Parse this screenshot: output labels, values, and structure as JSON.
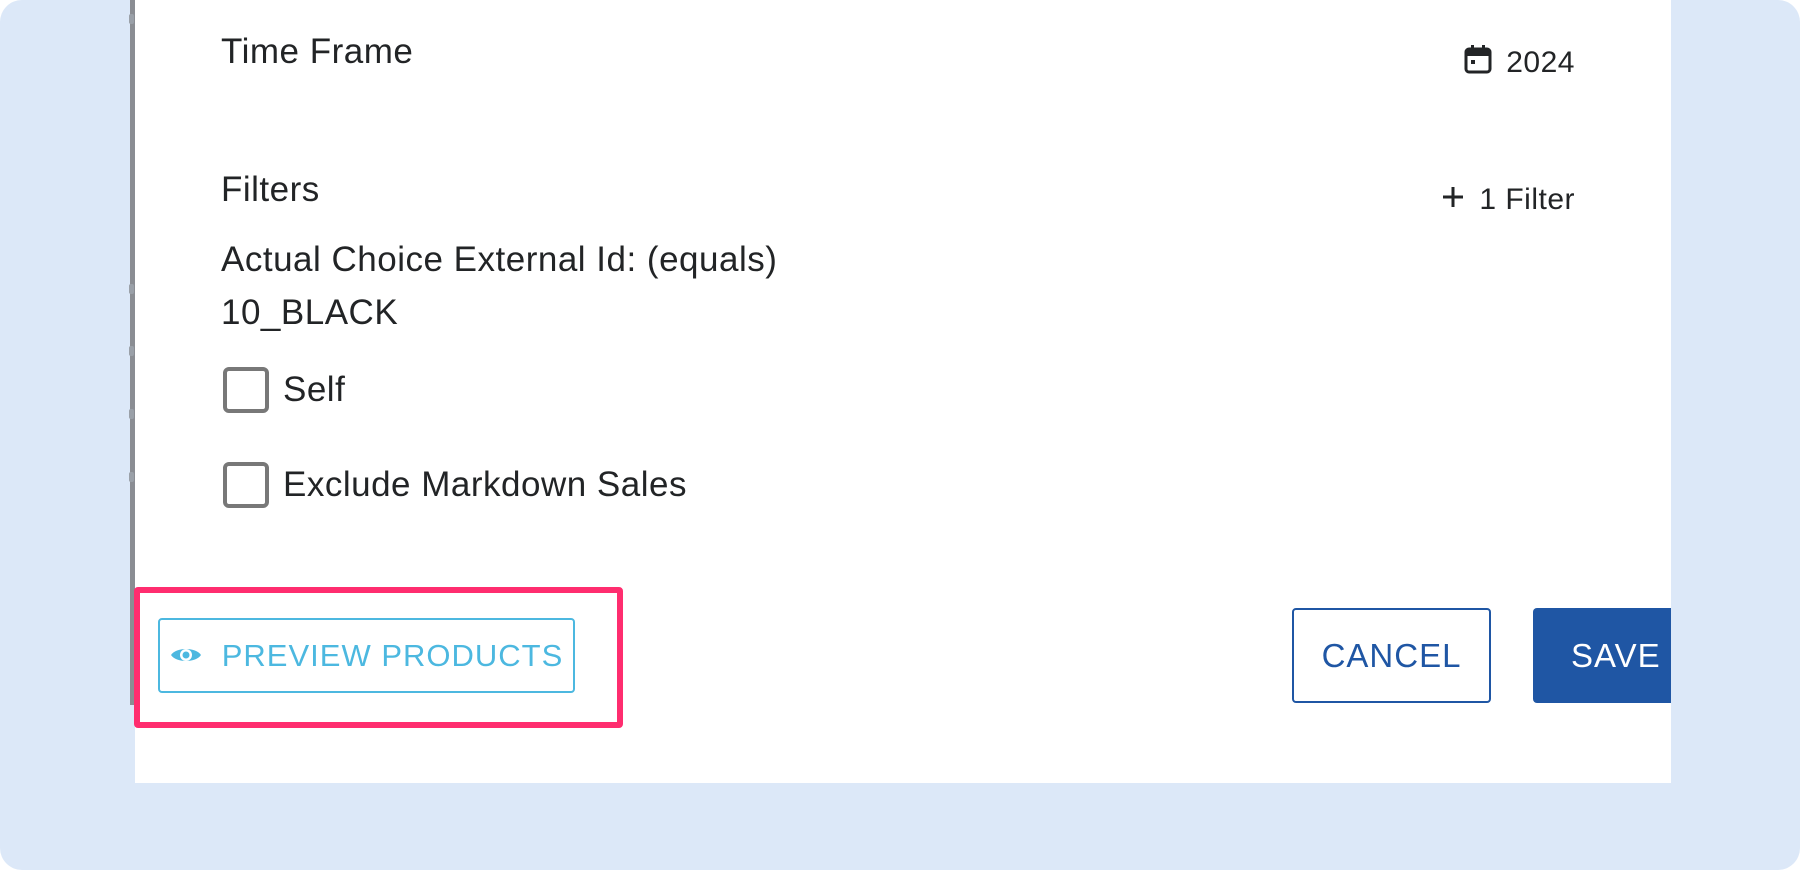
{
  "dialog": {
    "time_frame": {
      "title": "Time Frame",
      "value": "2024",
      "icon": "calendar-icon"
    },
    "filters": {
      "title": "Filters",
      "add_label": "1 Filter",
      "add_icon": "plus-icon",
      "filter_description": "Actual Choice External Id: (equals)",
      "filter_value": "10_BLACK"
    },
    "checkboxes": [
      {
        "label": "Self",
        "checked": false
      },
      {
        "label": "Exclude Markdown Sales",
        "checked": false
      }
    ],
    "actions": {
      "preview_label": "PREVIEW PRODUCTS",
      "preview_icon": "eye-icon",
      "cancel_label": "CANCEL",
      "save_label": "SAVE"
    }
  },
  "colors": {
    "background": "#dce8f8",
    "highlight": "#ff2d6f",
    "primary": "#1f56a4",
    "preview_accent": "#4cb8e0"
  }
}
